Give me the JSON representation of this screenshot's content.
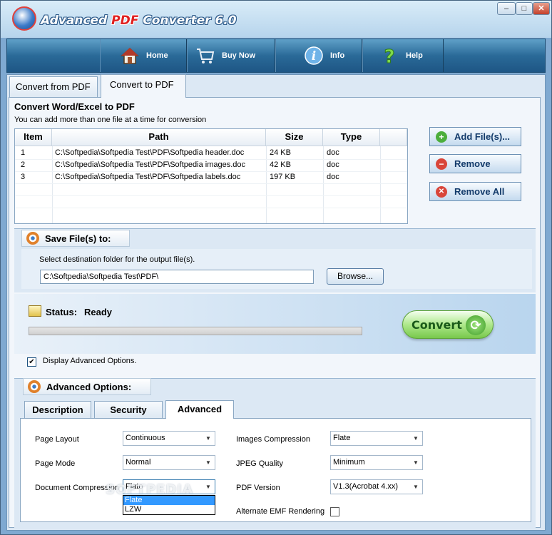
{
  "app": {
    "title_prefix": "Advanced ",
    "title_accent": "PDF",
    "title_suffix": " Converter 6.0"
  },
  "window_controls": {
    "minimize": "–",
    "maximize": "□",
    "close": "✕"
  },
  "nav": [
    {
      "label": "Home",
      "icon": "home-icon"
    },
    {
      "label": "Buy Now",
      "icon": "cart-icon"
    },
    {
      "label": "Info",
      "icon": "info-icon"
    },
    {
      "label": "Help",
      "icon": "help-icon"
    }
  ],
  "tabs": [
    "Convert from PDF",
    "Convert to PDF"
  ],
  "main": {
    "heading": "Convert Word/Excel to PDF",
    "subheading": "You can add more than one file at a time for conversion"
  },
  "file_table": {
    "columns": [
      "Item",
      "Path",
      "Size",
      "Type"
    ],
    "rows": [
      {
        "item": "1",
        "path": "C:\\Softpedia\\Softpedia Test\\PDF\\Softpedia header.doc",
        "size": "24 KB",
        "type": "doc"
      },
      {
        "item": "2",
        "path": "C:\\Softpedia\\Softpedia Test\\PDF\\Softpedia images.doc",
        "size": "42 KB",
        "type": "doc"
      },
      {
        "item": "3",
        "path": "C:\\Softpedia\\Softpedia Test\\PDF\\Softpedia labels.doc",
        "size": "197 KB",
        "type": "doc"
      }
    ]
  },
  "side_buttons": {
    "add": "Add File(s)...",
    "remove": "Remove",
    "remove_all": "Remove All"
  },
  "save": {
    "header": "Save File(s) to:",
    "instruction": "Select destination folder for the output file(s).",
    "path": "C:\\Softpedia\\Softpedia Test\\PDF\\",
    "browse": "Browse..."
  },
  "status": {
    "label": "Status:",
    "value": "Ready",
    "progress": 0
  },
  "convert_label": "Convert",
  "display_advanced": {
    "label": "Display Advanced Options.",
    "checked": true
  },
  "advanced": {
    "header": "Advanced Options:",
    "tabs": [
      "Description",
      "Security",
      "Advanced"
    ],
    "page_layout": {
      "label": "Page Layout",
      "value": "Continuous"
    },
    "page_mode": {
      "label": "Page Mode",
      "value": "Normal"
    },
    "doc_compression": {
      "label": "Document Compression",
      "value": "Flate",
      "options": [
        "Flate",
        "LZW"
      ]
    },
    "images_compression": {
      "label": "Images Compression",
      "value": "Flate"
    },
    "jpeg_quality": {
      "label": "JPEG Quality",
      "value": "Minimum"
    },
    "pdf_version": {
      "label": "PDF Version",
      "value": "V1.3(Acrobat 4.xx)"
    },
    "emf_rendering": {
      "label": "Alternate EMF Rendering",
      "checked": false
    }
  },
  "watermark": "SOFTPEDIA"
}
